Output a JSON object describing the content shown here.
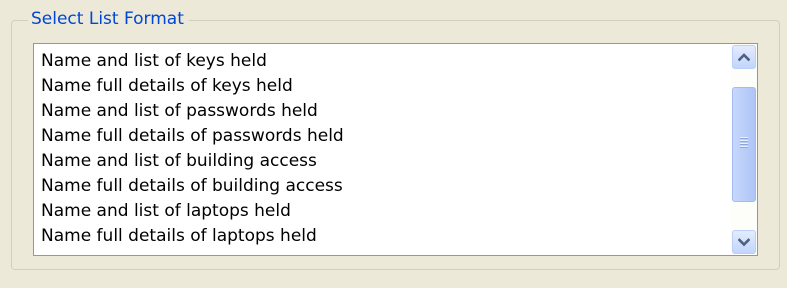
{
  "group": {
    "title": "Select List Format"
  },
  "list": {
    "items": [
      "Name and list of keys held",
      "Name full details of keys held",
      "Name and list of passwords held",
      "Name full details of passwords held",
      "Name and list of building access",
      "Name full details of building access",
      "Name and list of laptops held",
      "Name full details of laptops held"
    ]
  },
  "scrollbar": {
    "up_icon": "chevron-up-icon",
    "down_icon": "chevron-down-icon"
  },
  "colors": {
    "window_bg": "#ECE9D8",
    "legend_text": "#0046D5",
    "list_border": "#7F9DB9",
    "scroll_button": "#C2D5FC"
  }
}
